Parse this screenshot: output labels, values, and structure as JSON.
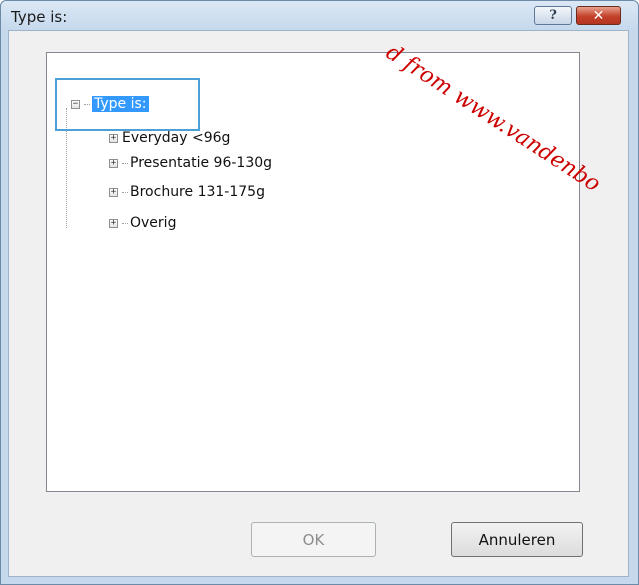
{
  "window": {
    "title": "Type is:"
  },
  "titlebar": {
    "help_glyph": "?",
    "close_glyph": "✕"
  },
  "tree": {
    "root": {
      "label": "Type is:",
      "expander": "−"
    },
    "items": [
      {
        "label": "Everyday <96g",
        "expander": "+"
      },
      {
        "label": "Presentatie 96-130g",
        "expander": "+"
      },
      {
        "label": "Brochure 131-175g",
        "expander": "+"
      },
      {
        "label": "Overig",
        "expander": "+"
      }
    ]
  },
  "buttons": {
    "ok_label": "OK",
    "cancel_label": "Annuleren",
    "ok_enabled": false
  },
  "watermark": {
    "text": "d from www.vandenbo"
  },
  "colors": {
    "selection": "#3399ff",
    "focus_frame": "#4ba0d8",
    "close_button": "#c4412a",
    "watermark": "#cc0000"
  },
  "icons": {
    "help": "help-icon",
    "close": "close-icon",
    "expand": "plus-box-icon",
    "collapse": "minus-box-icon"
  }
}
